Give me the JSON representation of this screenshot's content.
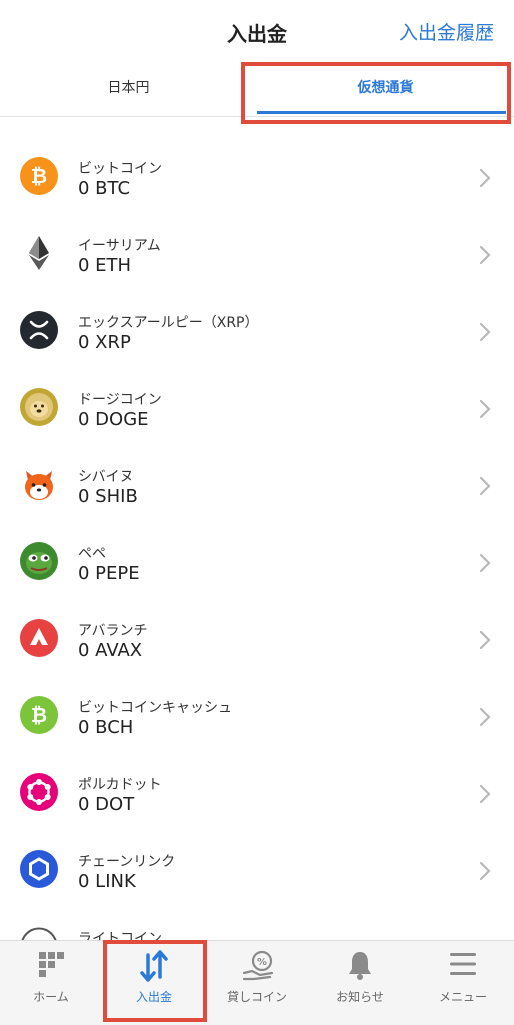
{
  "header": {
    "title": "入出金",
    "history_link": "入出金履歴"
  },
  "tabs": [
    {
      "label": "日本円"
    },
    {
      "label": "仮想通貨"
    }
  ],
  "coins": [
    {
      "name": "ビットコイン",
      "amount": "0 BTC",
      "icon": "bitcoin-icon",
      "color": "#F7931A"
    },
    {
      "name": "イーサリアム",
      "amount": "0 ETH",
      "icon": "ethereum-icon",
      "color": "#343434"
    },
    {
      "name": "エックスアールピー（XRP）",
      "amount": "0 XRP",
      "icon": "xrp-icon",
      "color": "#23292F"
    },
    {
      "name": "ドージコイン",
      "amount": "0 DOGE",
      "icon": "dogecoin-icon",
      "color": "#C2A633"
    },
    {
      "name": "シバイヌ",
      "amount": "0 SHIB",
      "icon": "shiba-icon",
      "color": "#F0651B"
    },
    {
      "name": "ペペ",
      "amount": "0 PEPE",
      "icon": "pepe-icon",
      "color": "#3D8A2F"
    },
    {
      "name": "アバランチ",
      "amount": "0 AVAX",
      "icon": "avalanche-icon",
      "color": "#E84142"
    },
    {
      "name": "ビットコインキャッシュ",
      "amount": "0 BCH",
      "icon": "bitcoin-cash-icon",
      "color": "#7CC53B"
    },
    {
      "name": "ポルカドット",
      "amount": "0 DOT",
      "icon": "polkadot-icon",
      "color": "#E6007A"
    },
    {
      "name": "チェーンリンク",
      "amount": "0 LINK",
      "icon": "chainlink-icon",
      "color": "#2A5ADA"
    },
    {
      "name": "ライトコイン",
      "amount": "",
      "icon": "litecoin-icon",
      "color": "#555555"
    }
  ],
  "nav": [
    {
      "label": "ホーム",
      "icon": "home-icon"
    },
    {
      "label": "入出金",
      "icon": "transfer-icon"
    },
    {
      "label": "貸しコイン",
      "icon": "lending-icon"
    },
    {
      "label": "お知らせ",
      "icon": "bell-icon"
    },
    {
      "label": "メニュー",
      "icon": "menu-icon"
    }
  ],
  "colors": {
    "accent": "#2c79d6",
    "highlight": "#e04b3b",
    "nav_inactive": "#8a8a8a"
  }
}
